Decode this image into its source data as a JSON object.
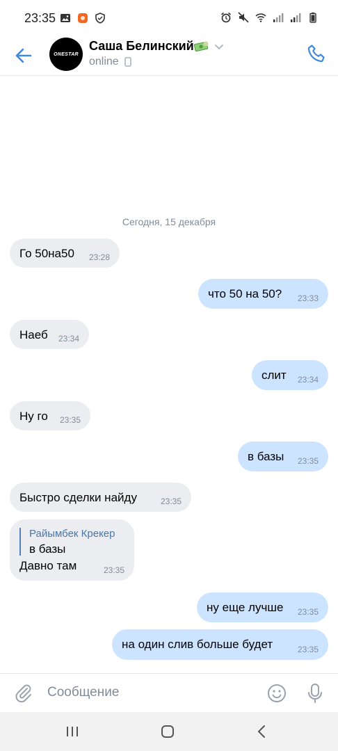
{
  "status_bar": {
    "time": "23:35",
    "left_icons": [
      "image-icon",
      "app-notification-icon",
      "shield-icon"
    ],
    "right_icons": [
      "alarm-icon",
      "mute-icon",
      "wifi-icon",
      "signal-icon",
      "signal-icon",
      "battery-icon"
    ]
  },
  "header": {
    "avatar_text": "ONESTAR",
    "name": "Саша Белинский",
    "status": "online",
    "accent_color": "#4a76a8"
  },
  "chat": {
    "date_separator": "Сегодня, 15 декабря",
    "messages": [
      {
        "direction": "in",
        "text": "Го 50на50",
        "time": "23:28"
      },
      {
        "direction": "out",
        "text": "что 50 на 50?",
        "time": "23:33"
      },
      {
        "direction": "in",
        "text": "Наеб",
        "time": "23:34"
      },
      {
        "direction": "out",
        "text": "слит",
        "time": "23:34"
      },
      {
        "direction": "in",
        "text": "Ну го",
        "time": "23:35"
      },
      {
        "direction": "out",
        "text": "в базы",
        "time": "23:35"
      },
      {
        "direction": "in",
        "text": "Быстро сделки найду",
        "time": "23:35"
      },
      {
        "direction": "in",
        "reply_author": "Райымбек Крекер",
        "reply_text": "в базы",
        "text": "Давно там",
        "time": "23:35"
      },
      {
        "direction": "out",
        "text": "ну еще лучше",
        "time": "23:35"
      },
      {
        "direction": "out",
        "text": "на один слив больше будет",
        "time": "23:35"
      }
    ]
  },
  "composer": {
    "placeholder": "Сообщение"
  },
  "colors": {
    "incoming_bubble": "#ebedf0",
    "outgoing_bubble": "#cce4ff",
    "secondary_text": "#818c99"
  }
}
